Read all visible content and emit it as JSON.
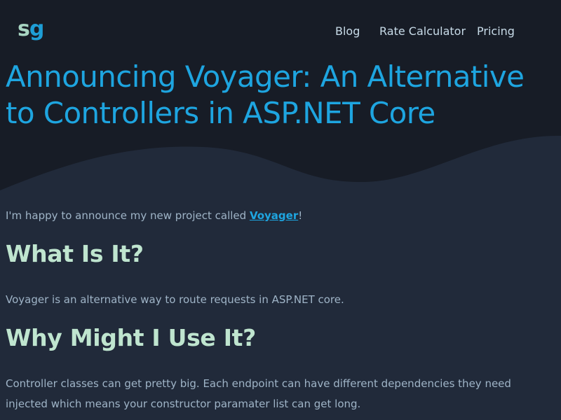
{
  "header": {
    "logo": {
      "s": "s",
      "g": "g"
    },
    "nav": [
      {
        "label": "Blog"
      },
      {
        "label": "Rate Calculator"
      },
      {
        "label": "Pricing"
      }
    ]
  },
  "article": {
    "title": "Announcing Voyager: An Alternative to Controllers in ASP.NET Core",
    "intro": {
      "before": "I'm happy to announce my new project called ",
      "link": "Voyager",
      "after": "!"
    },
    "sections": [
      {
        "heading": "What Is It?",
        "body": "Voyager is an alternative way to route requests in ASP.NET core."
      },
      {
        "heading": "Why Might I Use It?",
        "body": "Controller classes can get pretty big. Each endpoint can have different dependencies they need injected which means your constructor paramater list can get long."
      }
    ]
  },
  "colors": {
    "hero_background": "#171c26",
    "page_background": "#212a3a",
    "accent": "#1ea5e0",
    "heading": "#bfe5cf",
    "body_text": "#9fb4c7"
  }
}
